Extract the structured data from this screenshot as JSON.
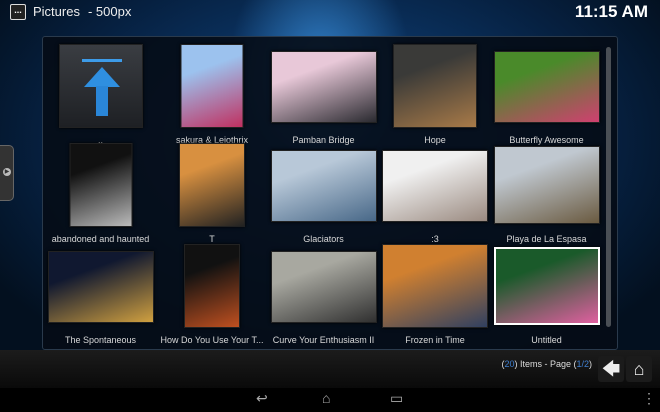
{
  "header": {
    "menu_icon": "...",
    "title": "Pictures",
    "subtitle": "- 500px",
    "clock": "11:15 AM"
  },
  "items": [
    {
      "label": "..",
      "type": "parent-folder"
    },
    {
      "label": "sakura & Leiothrix",
      "colors": [
        "#9cc2ee",
        "#c03060"
      ]
    },
    {
      "label": "Pamban Bridge",
      "colors": [
        "#e8c8d8",
        "#2a2a30"
      ]
    },
    {
      "label": "Hope",
      "colors": [
        "#3a3a38",
        "#a87a48"
      ]
    },
    {
      "label": "Butterfly Awesome",
      "colors": [
        "#4a8a2a",
        "#d04070"
      ]
    },
    {
      "label": "abandoned and haunted",
      "colors": [
        "#111111",
        "#bbbbbb"
      ]
    },
    {
      "label": "T",
      "colors": [
        "#d89040",
        "#222222"
      ]
    },
    {
      "label": "Glaciators",
      "colors": [
        "#b8c8d8",
        "#486888"
      ]
    },
    {
      "label": ":3",
      "colors": [
        "#f0f0f0",
        "#9a8a80"
      ]
    },
    {
      "label": "Playa de La Espasa",
      "colors": [
        "#c0c8d0",
        "#6a5a40"
      ]
    },
    {
      "label": "The Spontaneous",
      "colors": [
        "#101830",
        "#d0a040"
      ]
    },
    {
      "label": "How Do You Use Your T...",
      "colors": [
        "#111111",
        "#c05020"
      ]
    },
    {
      "label": "Curve Your Enthusiasm II",
      "colors": [
        "#a8a8a0",
        "#303030"
      ]
    },
    {
      "label": "Frozen in Time",
      "colors": [
        "#d08030",
        "#304060"
      ]
    },
    {
      "label": "Untitled",
      "colors": [
        "#1a5a2a",
        "#e060a0"
      ]
    }
  ],
  "footer": {
    "open_paren": "(",
    "count": "20",
    "items_text": ") Items - Page (",
    "page": "1/2",
    "close_paren": ")"
  },
  "buttons": {
    "back": "🡄",
    "home": "⌂"
  },
  "nav": {
    "back": "↩",
    "home": "⌂",
    "recents": "▭",
    "menu": "⋮"
  }
}
